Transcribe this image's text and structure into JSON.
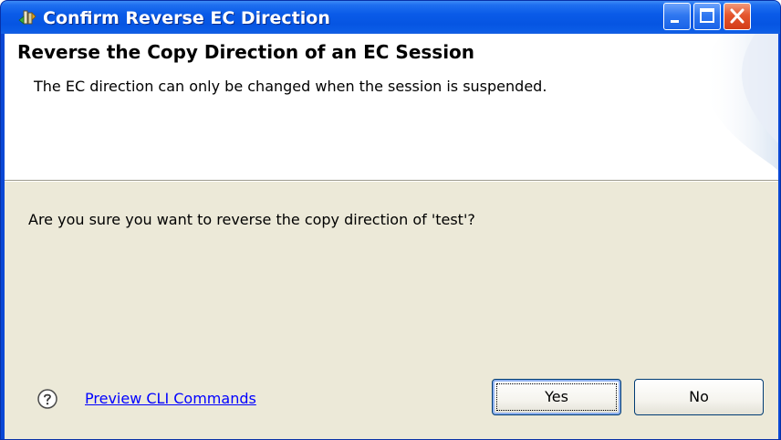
{
  "window": {
    "title": "Confirm Reverse EC Direction",
    "controls": {
      "minimize": "minimize-icon",
      "maximize": "maximize-icon",
      "close": "close-icon"
    }
  },
  "banner": {
    "title": "Reverse the Copy Direction of an EC Session",
    "description": "The EC direction can only be changed when the session is suspended."
  },
  "content": {
    "question": "Are you sure you want to reverse the copy direction of 'test'?"
  },
  "footer": {
    "help_icon": "help-icon",
    "preview_link": "Preview CLI Commands",
    "yes_label": "Yes",
    "no_label": "No"
  },
  "colors": {
    "titlebar": "#0a5be8",
    "content_background": "#ece9d8",
    "link": "#0000ff",
    "close_button": "#d33d18"
  }
}
